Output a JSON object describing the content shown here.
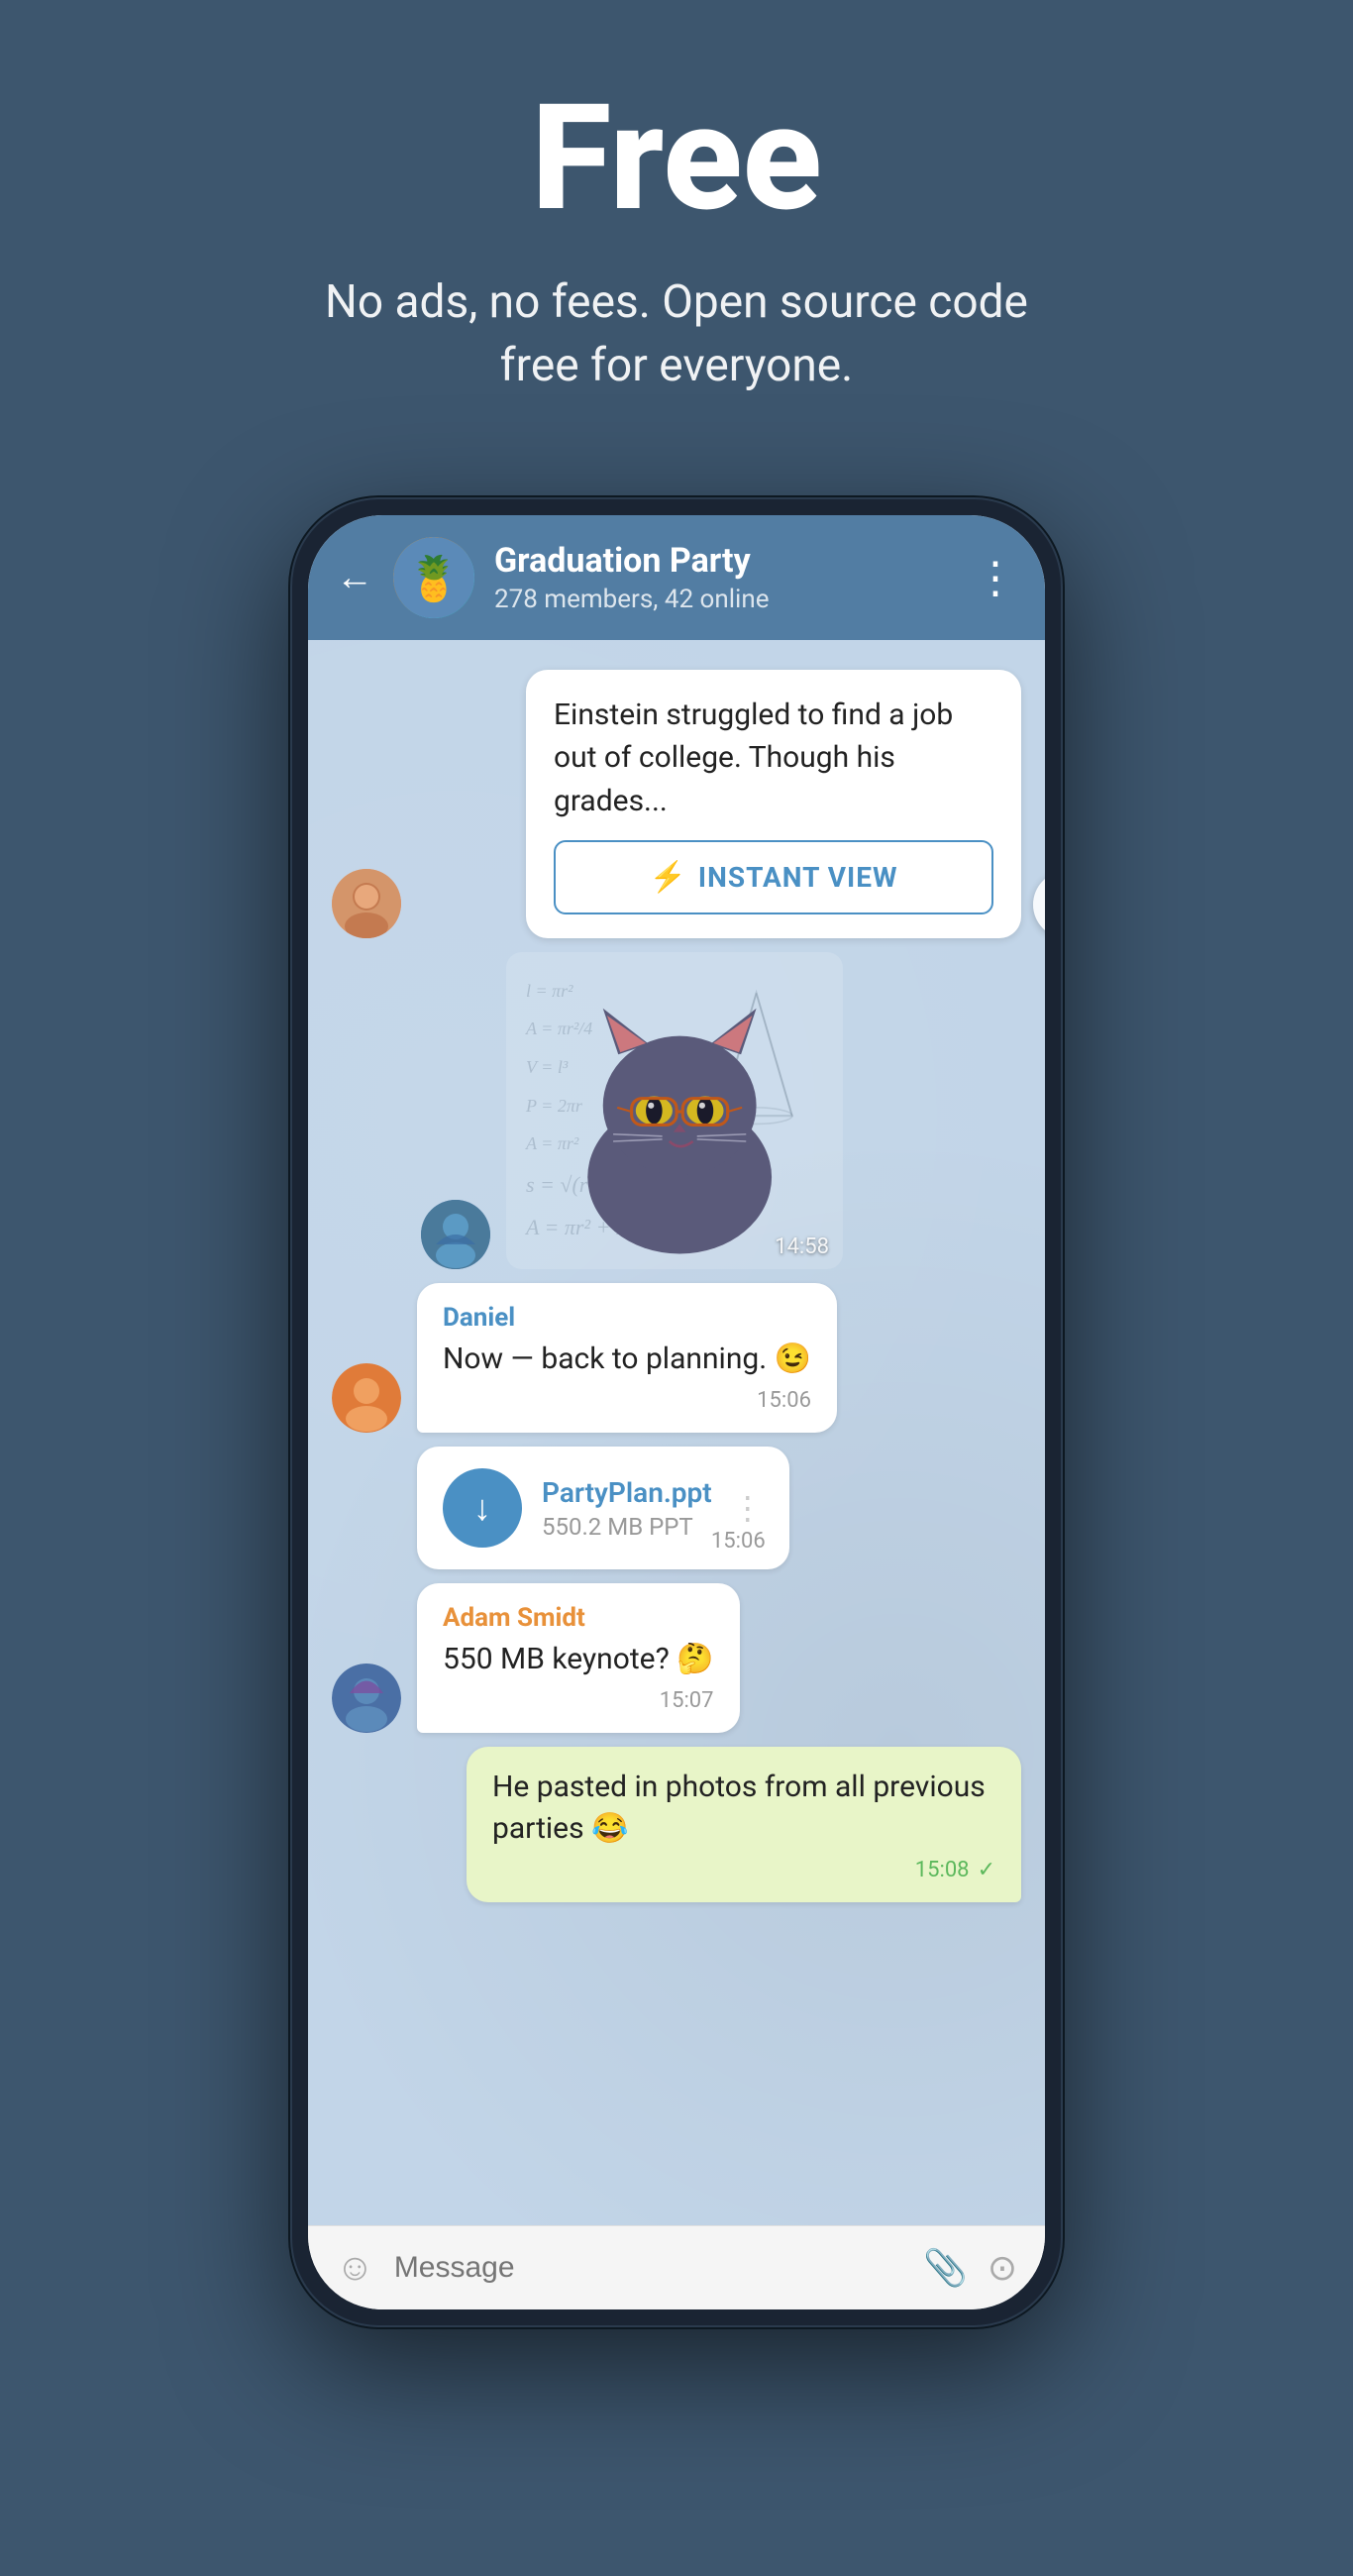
{
  "hero": {
    "title": "Free",
    "subtitle": "No ads, no fees. Open source code free for everyone."
  },
  "chat": {
    "name": "Graduation Party",
    "members": "278 members, 42 online",
    "avatar_emoji": "🍍"
  },
  "messages": [
    {
      "id": "instant-view-msg",
      "type": "instant-view",
      "text": "Einstein struggled to find a job out of college. Though his grades...",
      "button_label": "INSTANT VIEW"
    },
    {
      "id": "sticker-msg",
      "type": "sticker",
      "time": "14:58"
    },
    {
      "id": "daniel-msg",
      "type": "text",
      "sender": "Daniel",
      "text": "Now — back to planning. 😉",
      "time": "15:06",
      "side": "left"
    },
    {
      "id": "file-msg",
      "type": "file",
      "file_name": "PartyPlan.ppt",
      "file_size": "550.2 MB PPT",
      "time": "15:06",
      "side": "left"
    },
    {
      "id": "adam-msg",
      "type": "text",
      "sender": "Adam Smidt",
      "text": "550 MB keynote? 🤔",
      "time": "15:07",
      "side": "left"
    },
    {
      "id": "own-msg",
      "type": "text",
      "sender": "",
      "text": "He pasted in photos from all previous parties 😂",
      "time": "15:08",
      "side": "right",
      "read": true
    }
  ],
  "input": {
    "placeholder": "Message"
  },
  "icons": {
    "back": "←",
    "menu": "⋮",
    "share": "↗",
    "lightning": "⚡",
    "download": "↓",
    "emoji": "☺",
    "attach": "📎",
    "camera": "⊙",
    "check": "✓"
  }
}
